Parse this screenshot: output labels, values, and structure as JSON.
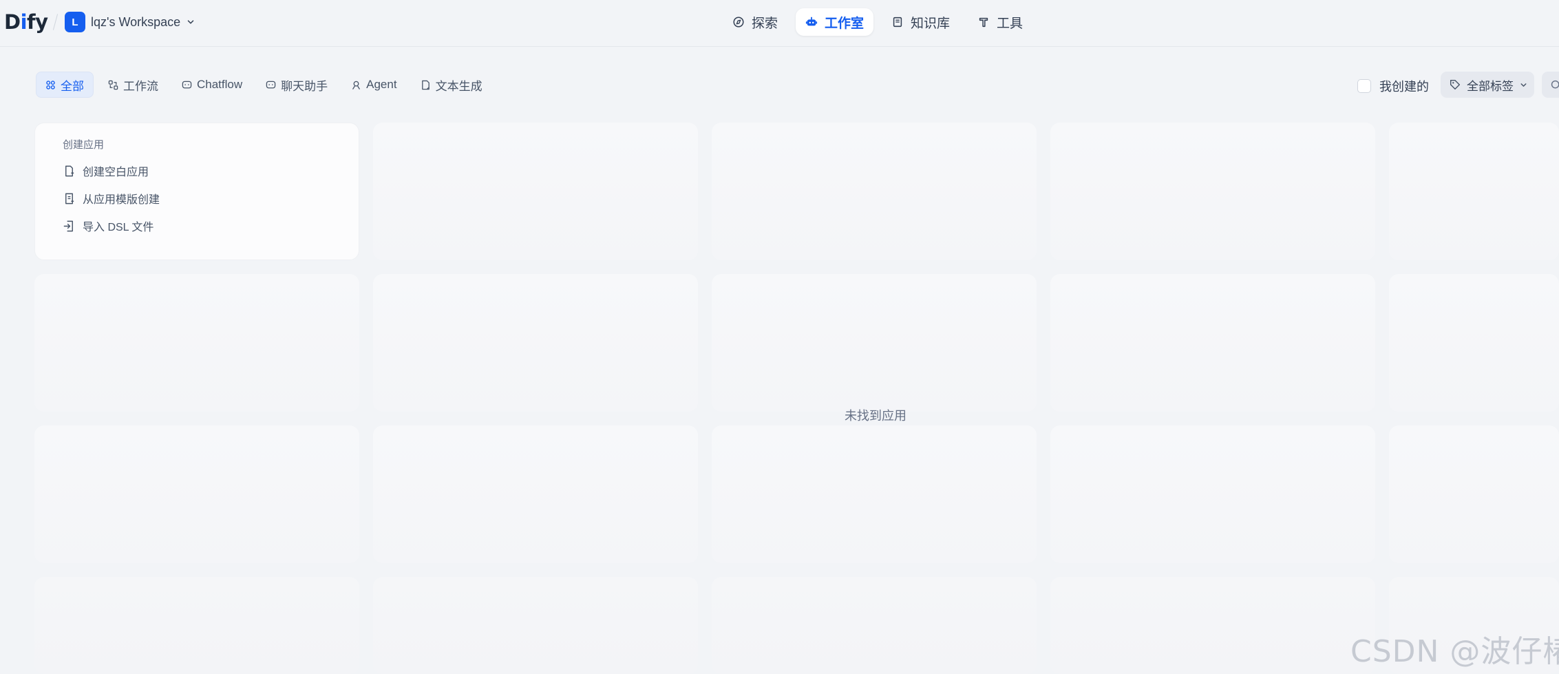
{
  "header": {
    "logo_prefix": "D",
    "logo_accent": "i",
    "logo_suffix": "fy",
    "workspace_initial": "L",
    "workspace_name": "lqz's Workspace",
    "nav": [
      {
        "label": "探索",
        "icon": "compass-icon"
      },
      {
        "label": "工作室",
        "icon": "robot-icon"
      },
      {
        "label": "知识库",
        "icon": "book-icon"
      },
      {
        "label": "工具",
        "icon": "hammer-icon"
      }
    ],
    "active_nav": "工作室"
  },
  "filters": {
    "tabs": [
      {
        "label": "全部",
        "icon": "grid-icon"
      },
      {
        "label": "工作流",
        "icon": "workflow-icon"
      },
      {
        "label": "Chatflow",
        "icon": "chatflow-icon"
      },
      {
        "label": "聊天助手",
        "icon": "chat-bubble-icon"
      },
      {
        "label": "Agent",
        "icon": "agent-icon"
      },
      {
        "label": "文本生成",
        "icon": "document-icon"
      }
    ],
    "active_tab": "全部",
    "created_by_me": "我创建的",
    "tags_label": "全部标签"
  },
  "create_app": {
    "title": "创建应用",
    "items": [
      {
        "label": "创建空白应用",
        "icon": "file-plus-icon"
      },
      {
        "label": "从应用模版创建",
        "icon": "template-icon"
      },
      {
        "label": "导入 DSL 文件",
        "icon": "file-import-icon"
      }
    ]
  },
  "empty_text": "未找到应用",
  "watermark": "CSDN @波仔椿",
  "colors": {
    "accent": "#155eef",
    "background": "#f2f4f7"
  }
}
